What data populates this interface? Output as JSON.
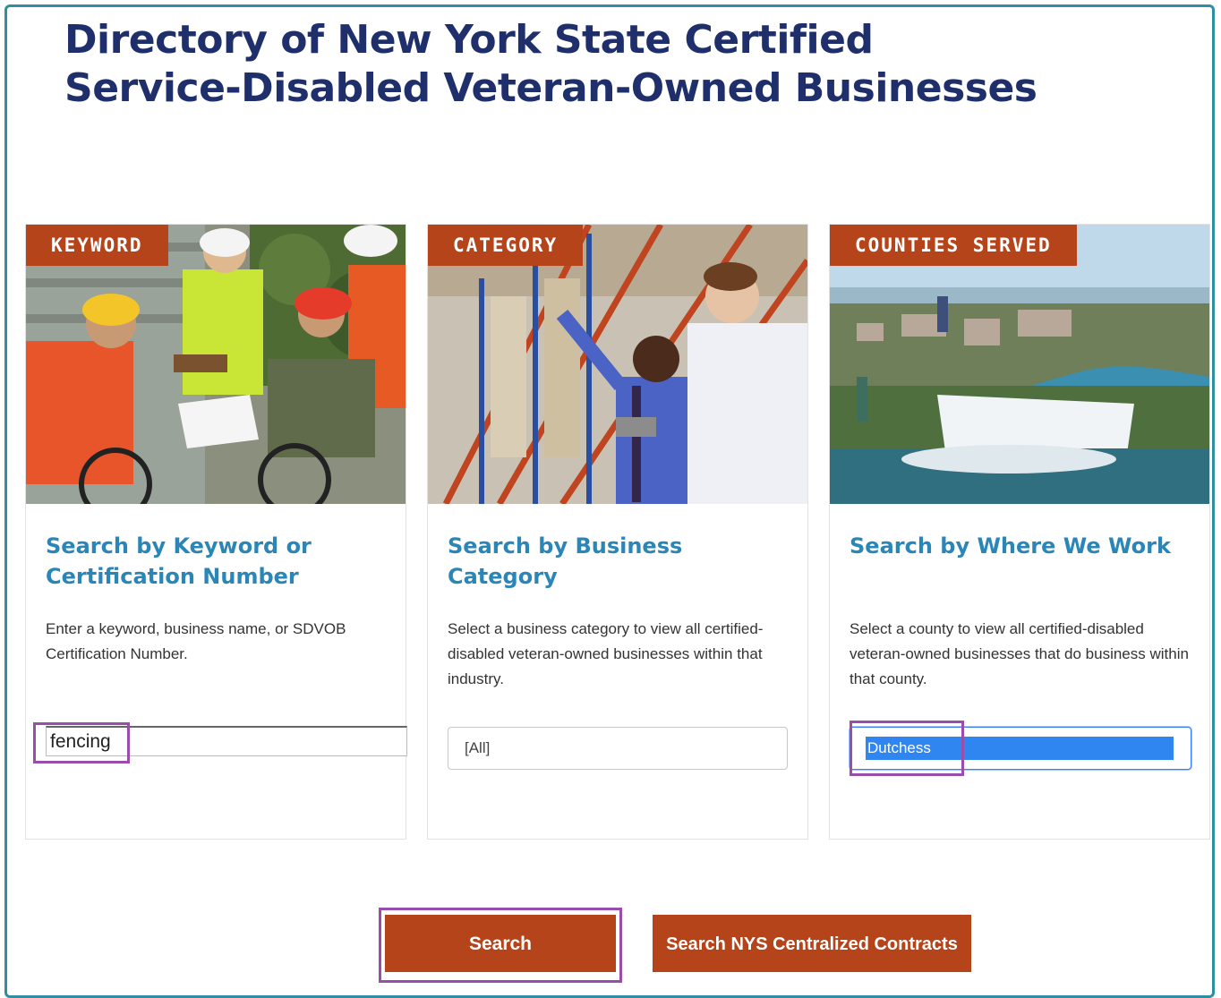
{
  "page": {
    "title_line1": "Directory of New York State Certified",
    "title_line2": "Service-Disabled Veteran-Owned Businesses"
  },
  "cards": {
    "keyword": {
      "tag": "KEYWORD",
      "heading": "Search by Keyword or Certification Number",
      "description": "Enter a keyword, business name, or SDVOB Certification Number.",
      "input_value": "fencing"
    },
    "category": {
      "tag": "CATEGORY",
      "heading": "Search by Business Category",
      "description": "Select a business category to view all certified-disabled veteran-owned businesses within that industry.",
      "selected": "[All]"
    },
    "counties": {
      "tag": "COUNTIES SERVED",
      "heading": "Search by Where We Work",
      "description": "Select a county to view all certified-disabled veteran-owned businesses that do business within that county.",
      "selected": "Dutchess"
    }
  },
  "buttons": {
    "search": "Search",
    "centralized": "Search NYS Centralized Contracts"
  },
  "colors": {
    "title": "#1f2f6b",
    "heading": "#2b86b8",
    "accent": "#b5441a",
    "frame": "#2e8fa3",
    "highlight": "#9b4dab"
  }
}
